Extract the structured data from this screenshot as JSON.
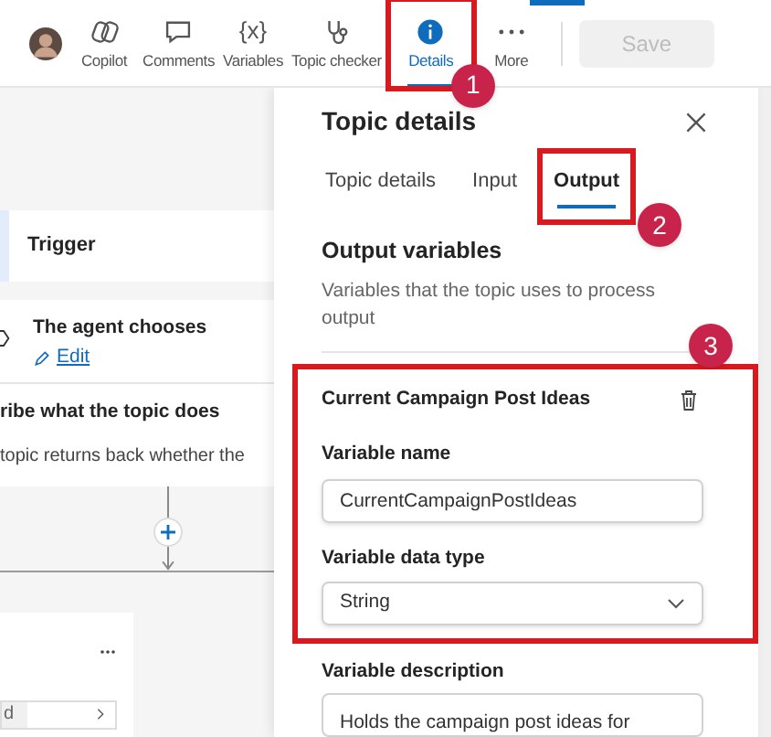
{
  "toolbar": {
    "items": [
      {
        "kind": "copilot",
        "label": "Copilot",
        "selected": false
      },
      {
        "kind": "comments",
        "label": "Comments",
        "selected": false
      },
      {
        "kind": "variables",
        "glyph": "{x}",
        "label": "Variables",
        "selected": false
      },
      {
        "kind": "checker",
        "label": "Topic checker",
        "selected": false
      },
      {
        "kind": "details",
        "label": "Details",
        "selected": true,
        "callout": "1"
      },
      {
        "kind": "more",
        "label": "More",
        "selected": false
      }
    ],
    "save_button": {
      "label": "Save",
      "disabled": true
    }
  },
  "canvas": {
    "trigger": {
      "label": "Trigger"
    },
    "node": {
      "title": "The agent chooses",
      "link": "Edit"
    },
    "description": {
      "title": "ribe what the topic does",
      "text": "topic returns back whether the"
    },
    "card": {
      "field_fragment": "d"
    }
  },
  "panel": {
    "title": "Topic details",
    "tabs": [
      {
        "label": "Topic details",
        "selected": false
      },
      {
        "label": "Input",
        "selected": false
      },
      {
        "label": "Output",
        "selected": true,
        "callout": "2"
      }
    ],
    "section_title": "Output variables",
    "section_text": "Variables that the topic uses to process output",
    "variable": {
      "callout": "3",
      "title": "Current Campaign Post Ideas",
      "name_label": "Variable name",
      "name_value": "CurrentCampaignPostIdeas",
      "type_label": "Variable data type",
      "type_value": "String",
      "description_label": "Variable description",
      "description_value": "Holds the campaign post ideas for"
    }
  }
}
